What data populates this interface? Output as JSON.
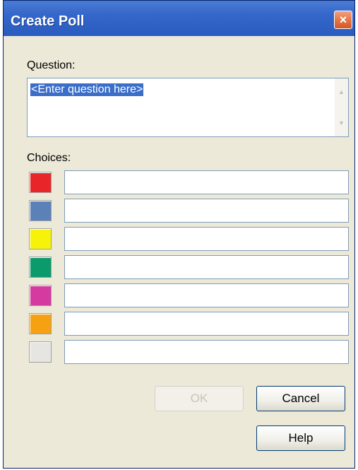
{
  "dialog": {
    "title": "Create Poll",
    "close_glyph": "×"
  },
  "question": {
    "label": "Question:",
    "placeholder": "<Enter question here>"
  },
  "choices": {
    "label": "Choices:",
    "items": [
      {
        "color": "#e8262a",
        "value": ""
      },
      {
        "color": "#5b81b8",
        "value": ""
      },
      {
        "color": "#f6f20a",
        "value": ""
      },
      {
        "color": "#0b9a6c",
        "value": ""
      },
      {
        "color": "#d43aa0",
        "value": ""
      },
      {
        "color": "#f5a111",
        "value": ""
      },
      {
        "color": "#e6e5e1",
        "value": ""
      }
    ]
  },
  "buttons": {
    "ok": "OK",
    "cancel": "Cancel",
    "help": "Help"
  }
}
